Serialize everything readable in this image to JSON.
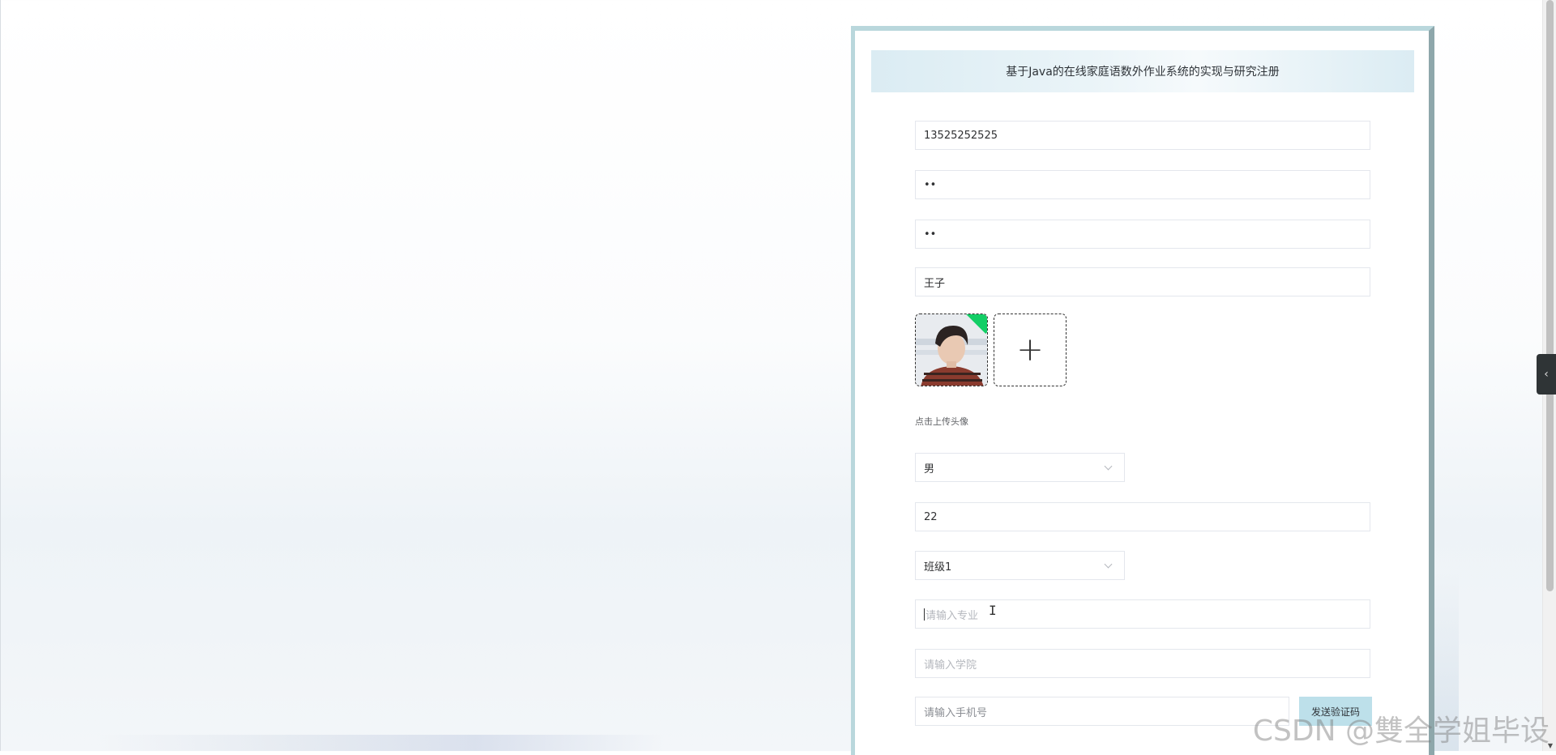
{
  "register": {
    "title": "基于Java的在线家庭语数外作业系统的实现与研究注册",
    "account_value": "13525252525",
    "password_value": "••",
    "confirm_password_value": "••",
    "name_value": "王子",
    "avatar_tip": "点击上传头像",
    "upload_add_glyph": "+",
    "gender_value": "男",
    "age_value": "22",
    "class_value": "班级1",
    "major_placeholder": "请输入专业",
    "college_placeholder": "请输入学院",
    "phone_placeholder": "请输入手机号",
    "send_code_label": "发送验证码"
  },
  "side_toggle_glyph": "‹",
  "watermark": "CSDN @雙全学姐毕设",
  "colors": {
    "header_bg": "#dbecf3",
    "panel_border": "#b9d7dc",
    "send_button_bg": "#bde0ea",
    "upload_badge": "#13ce66"
  },
  "icons": [
    "plus-icon",
    "chevron-down-icon",
    "chevron-left-icon",
    "check-badge-icon"
  ]
}
